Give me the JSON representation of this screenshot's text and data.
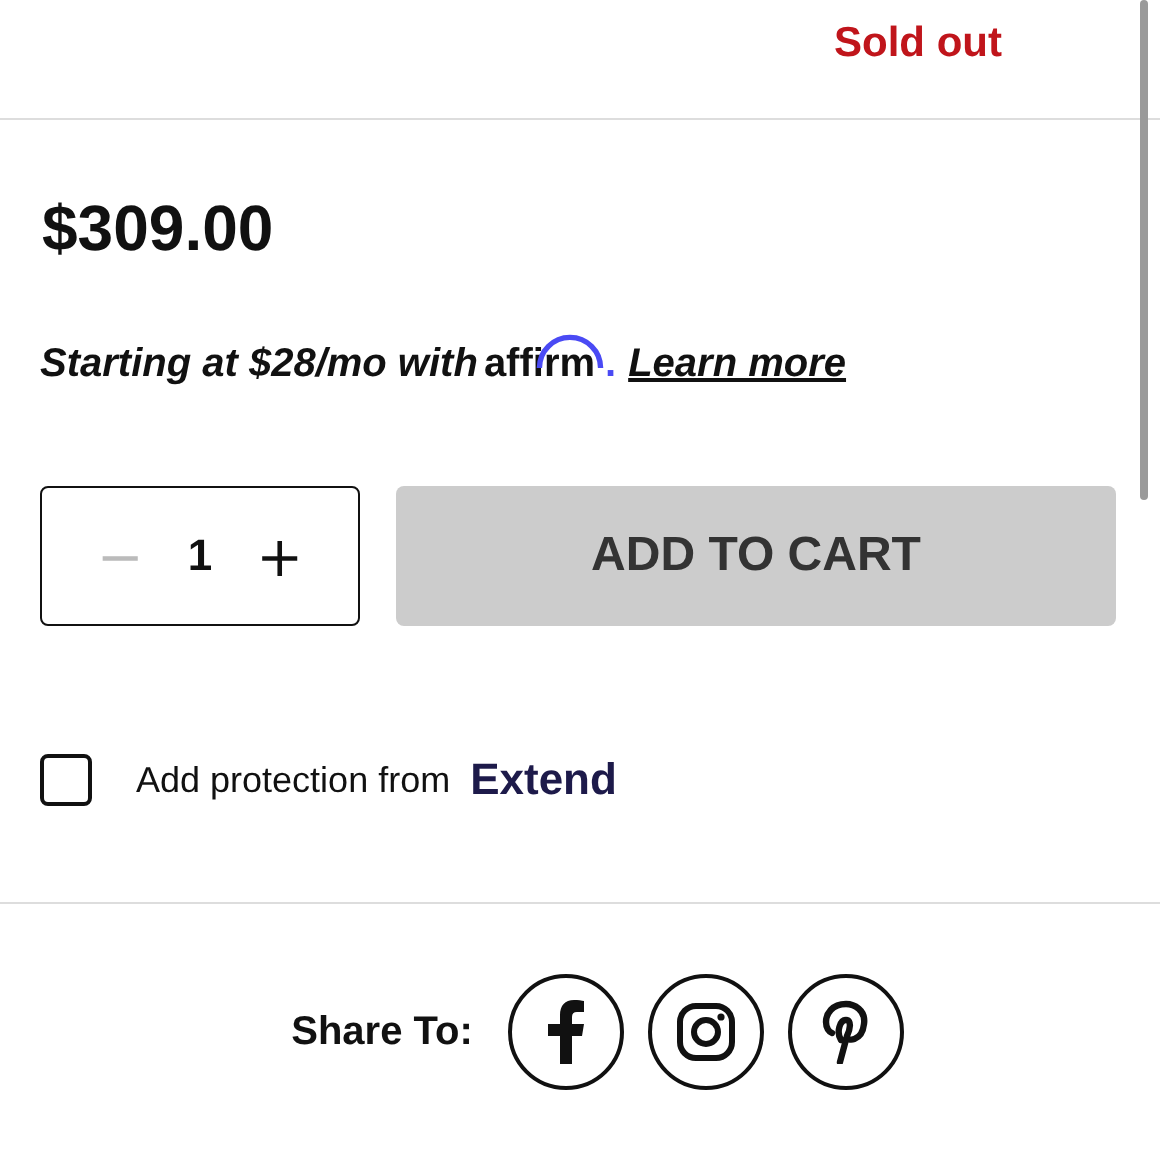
{
  "stock": {
    "status": "Sold out"
  },
  "price": "$309.00",
  "financing": {
    "text": "Starting at $28/mo with",
    "provider": "affirm",
    "punctuation": ".",
    "link": "Learn more"
  },
  "quantity": {
    "decrement": "−",
    "value": "1",
    "increment": "+"
  },
  "cart_button": {
    "label": "ADD TO CART",
    "disabled": true
  },
  "protection": {
    "label": "Add protection from",
    "provider": "Extend",
    "checked": false
  },
  "share": {
    "label": "Share To:",
    "networks": [
      {
        "kind": "facebook"
      },
      {
        "kind": "instagram"
      },
      {
        "kind": "pinterest"
      }
    ]
  }
}
